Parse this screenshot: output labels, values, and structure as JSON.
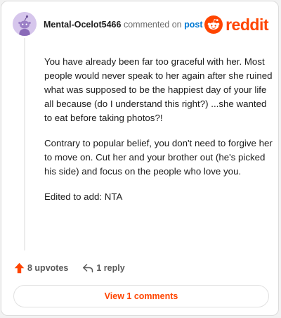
{
  "comment": {
    "username": "Mental-Ocelot5466",
    "commented_on": "commented on",
    "post_link": "post",
    "paragraphs": [
      "You have already been far too graceful with her. Most people would never speak to her again after she ruined what was supposed to be the happiest day of your life all because (do I understand this right?) ...she wanted to eat before taking photos?!",
      "Contrary to popular belief, you don't need to forgive her to move on. Cut her and your brother out (he's picked his side) and focus on the people who love you.",
      "Edited to add: NTA"
    ]
  },
  "brand": {
    "wordmark": "reddit",
    "color": "#ff4500"
  },
  "actions": {
    "upvotes_label": "8 upvotes",
    "reply_label": "1 reply"
  },
  "footer": {
    "view_comments_label": "View 1 comments"
  },
  "icons": {
    "avatar": "snoo-avatar-icon",
    "brand": "reddit-logo-icon",
    "upvote": "upvote-arrow-icon",
    "reply": "reply-arrow-icon"
  }
}
